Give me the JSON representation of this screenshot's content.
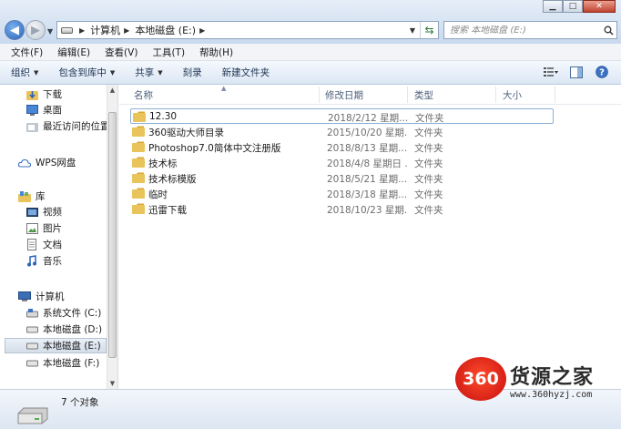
{
  "window": {
    "minimize": "▁",
    "maximize": "□",
    "close": "✕"
  },
  "address": {
    "breadcrumbs": [
      "计算机",
      "本地磁盘 (E:)"
    ]
  },
  "search": {
    "placeholder": "搜索 本地磁盘 (E:)"
  },
  "menu": [
    "文件(F)",
    "编辑(E)",
    "查看(V)",
    "工具(T)",
    "帮助(H)"
  ],
  "toolbar": {
    "organize": "组织",
    "include_library": "包含到库中",
    "share": "共享",
    "burn": "刻录",
    "new_folder": "新建文件夹"
  },
  "nav": {
    "downloads": "下载",
    "desktop": "桌面",
    "recent": "最近访问的位置",
    "wps": "WPS网盘",
    "libraries": "库",
    "videos": "视频",
    "pictures": "图片",
    "documents": "文档",
    "music": "音乐",
    "computer": "计算机",
    "drive_c": "系统文件 (C:)",
    "drive_d": "本地磁盘 (D:)",
    "drive_e": "本地磁盘 (E:)",
    "drive_f": "本地磁盘 (F:)"
  },
  "columns": {
    "name": "名称",
    "modified": "修改日期",
    "type": "类型",
    "size": "大小"
  },
  "files": [
    {
      "name": "12.30",
      "date": "2018/2/12 星期...",
      "type": "文件夹"
    },
    {
      "name": "360驱动大师目录",
      "date": "2015/10/20 星期...",
      "type": "文件夹"
    },
    {
      "name": "Photoshop7.0简体中文注册版",
      "date": "2018/8/13 星期...",
      "type": "文件夹"
    },
    {
      "name": "技术标",
      "date": "2018/4/8 星期日 ...",
      "type": "文件夹"
    },
    {
      "name": "技术标模版",
      "date": "2018/5/21 星期...",
      "type": "文件夹"
    },
    {
      "name": "临时",
      "date": "2018/3/18 星期...",
      "type": "文件夹"
    },
    {
      "name": "迅雷下载",
      "date": "2018/10/23 星期...",
      "type": "文件夹"
    }
  ],
  "status": {
    "count": "7 个对象"
  },
  "watermark": {
    "logo": "360",
    "brand": "货源之家",
    "url": "www.360hyzj.com"
  },
  "colors": {
    "folder": "#e8c45a",
    "accent": "#2a63b8",
    "watermark_red": "#e3211b"
  }
}
